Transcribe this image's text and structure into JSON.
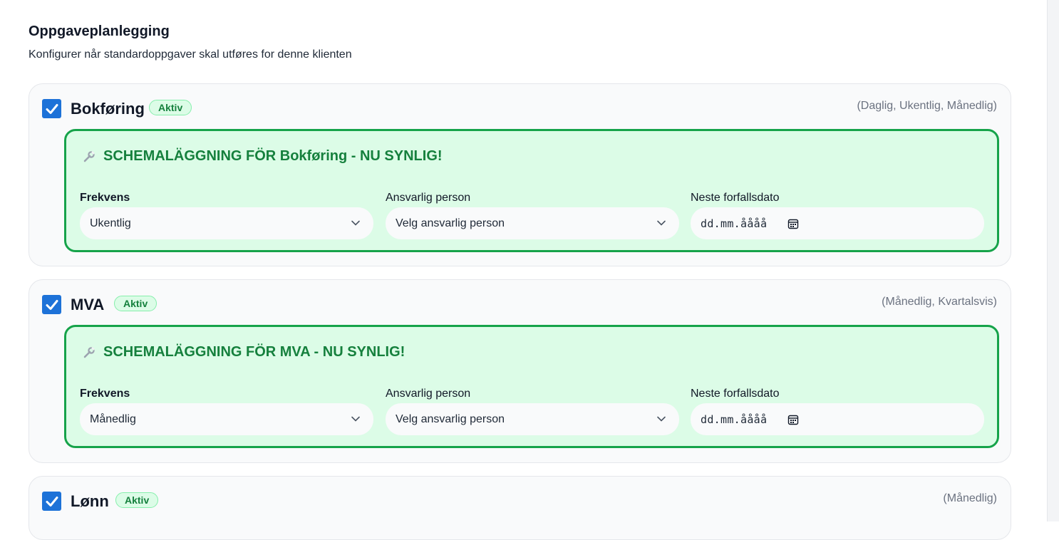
{
  "section": {
    "title": "Oppgaveplanlegging",
    "subtitle": "Konfigurer når standardoppgaver skal utføres for denne klienten"
  },
  "tasks": [
    {
      "name": "Bokføring",
      "badge": "Aktiv",
      "frequency_options": "(Daglig, Ukentlig, Månedlig)",
      "checked": true,
      "schedule": {
        "banner": "SCHEMALÄGGNING FÖR Bokføring - NU SYNLIG!",
        "frequency_label": "Frekvens",
        "frequency_value": "Ukentlig",
        "owner_label": "Ansvarlig person",
        "owner_value": "Velg ansvarlig person",
        "due_label": "Neste forfallsdato",
        "due_placeholder": "dd.mm.åååå"
      }
    },
    {
      "name": "MVA",
      "badge": "Aktiv",
      "frequency_options": "(Månedlig, Kvartalsvis)",
      "checked": true,
      "schedule": {
        "banner": "SCHEMALÄGGNING FÖR MVA - NU SYNLIG!",
        "frequency_label": "Frekvens",
        "frequency_value": "Månedlig",
        "owner_label": "Ansvarlig person",
        "owner_value": "Velg ansvarlig person",
        "due_label": "Neste forfallsdato",
        "due_placeholder": "dd.mm.åååå"
      }
    },
    {
      "name": "Lønn",
      "badge": "Aktiv",
      "frequency_options": "(Månedlig)",
      "checked": true
    }
  ],
  "colors": {
    "accent_green": "#16a34a",
    "banner_bg": "#dcfce7",
    "checkbox_blue": "#1d72d8"
  },
  "icons": [
    "check-icon",
    "wrench-icon",
    "chevron-down-icon",
    "calendar-icon"
  ]
}
